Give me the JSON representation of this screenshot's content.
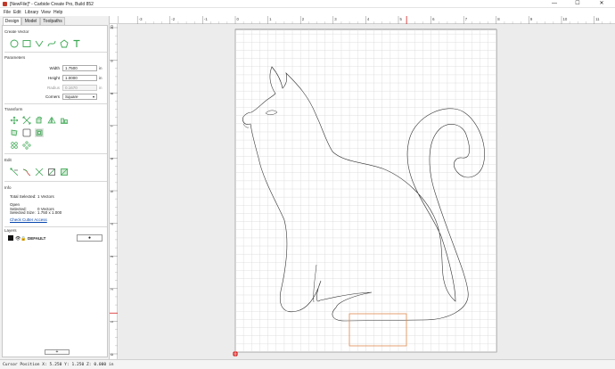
{
  "window": {
    "title": "[NewFile]* - Carbide Create Pro, Build 852",
    "minimize_glyph": "—",
    "maximize_glyph": "☐",
    "close_glyph": "✕"
  },
  "menu": {
    "items": [
      "File",
      "Edit",
      "Library",
      "View",
      "Help"
    ]
  },
  "tabs": {
    "design": "Design",
    "model": "Model",
    "toolpaths": "Toolpaths"
  },
  "sections": {
    "create_vector": "Create Vector",
    "parameters": "Parameters",
    "transform": "Transform",
    "edit": "Edit",
    "info": "Info",
    "layers": "Layers"
  },
  "create_vector_tools": [
    "circle-icon",
    "rectangle-icon",
    "polyline-icon",
    "curve-icon",
    "polygon-icon",
    "text-icon"
  ],
  "parameters": {
    "width_label": "Width",
    "width_value": "1.7500",
    "width_unit": "in",
    "height_label": "Height",
    "height_value": "1.0000",
    "height_unit": "in",
    "radius_label": "Radius",
    "radius_value": "0.1670",
    "radius_unit": "in",
    "corners_label": "Corners",
    "corners_value": "Square"
  },
  "transform_tools": [
    "move-icon",
    "scale-icon",
    "rotate-icon",
    "mirror-icon",
    "align-icon",
    "size-icon",
    "offset-icon",
    "array-icon",
    "group-icon",
    "circular-array-icon"
  ],
  "edit_tools": [
    "node-edit-icon",
    "join-icon",
    "trim-icon",
    "boolean-icon",
    "fill-icon"
  ],
  "info": {
    "total_selected_label": "Total Selected:",
    "total_selected_value": "1 Vectors",
    "open_selected_label": "Open Selected:",
    "open_selected_value": "0 Vectors",
    "selected_size_label": "Selected Size:",
    "selected_size_value": "1.750 x 1.000",
    "check_cutter_access": "Check Cutter Access"
  },
  "layers": {
    "items": [
      {
        "name": "DEFAULT",
        "color": "#111111"
      }
    ],
    "layer_button_glyph": "●",
    "add_button": "+"
  },
  "ruler": {
    "h_labels": [
      "-3",
      "-2",
      "-1",
      "0",
      "1",
      "2",
      "3",
      "4",
      "5",
      "6",
      "7",
      "8",
      "9",
      "10",
      "11"
    ],
    "v_labels": [
      "10",
      "9",
      "8",
      "7",
      "6",
      "5",
      "4",
      "3",
      "2",
      "1",
      "0",
      "-1"
    ]
  },
  "colors": {
    "accent_green": "#3aa651",
    "selection": "#e08a50",
    "origin_marker": "#d62020",
    "grid": "#d4d4d4",
    "vector": "#333333"
  },
  "status": {
    "cursor": "Cursor Position X: 5.250 Y: 1.250 Z: 0.000 in"
  }
}
